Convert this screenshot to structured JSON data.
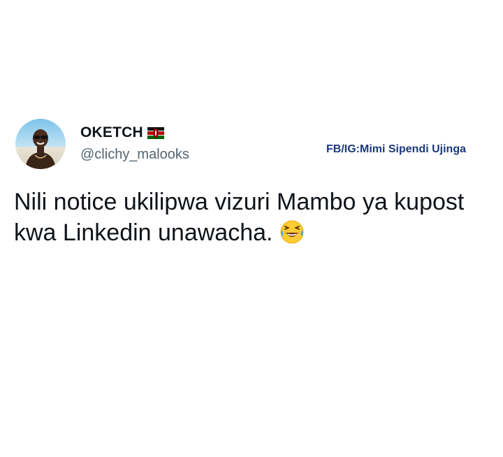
{
  "tweet": {
    "author": {
      "display_name": "OKETCH",
      "handle": "@clichy_malooks",
      "flag_icon": "kenya-flag-icon",
      "avatar_icon": "user-avatar"
    },
    "watermark": "FB/IG:Mimi Sipendi Ujinga",
    "text": "Nili notice ukilipwa vizuri Mambo ya kupost kwa Linkedin unawacha.",
    "emoji_icon": "face-with-tears-of-joy-icon"
  },
  "colors": {
    "background": "#ffffff",
    "text": "#0f1419",
    "handle": "#536471",
    "watermark": "#1a3a7a"
  }
}
